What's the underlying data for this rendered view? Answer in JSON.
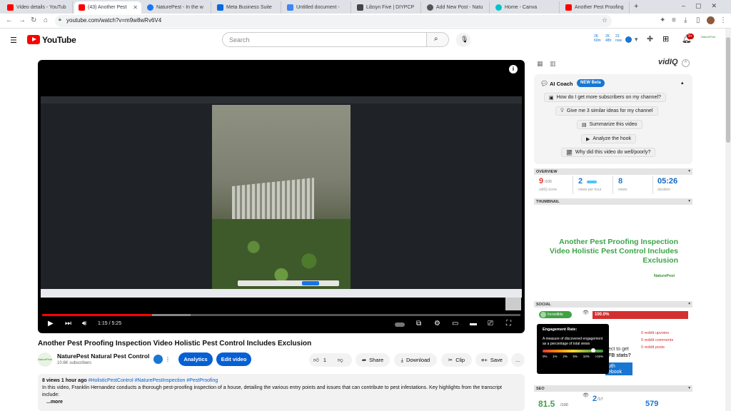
{
  "browser": {
    "tabs": [
      {
        "label": "Video details - YouTub",
        "color": "#ff0000"
      },
      {
        "label": "(43) Another Pest",
        "color": "#ff0000"
      },
      {
        "label": "NaturePest - In the w",
        "color": "#1877f2"
      },
      {
        "label": "Meta Business Suite",
        "color": "#0668e1"
      },
      {
        "label": "Untitled document -",
        "color": "#4285f4"
      },
      {
        "label": "Libsyn Five | DIYPCP",
        "color": "#444444"
      },
      {
        "label": "Add New Post - Natu",
        "color": "#555555"
      },
      {
        "label": "Home - Canva",
        "color": "#00c4cc"
      },
      {
        "label": "Another Pest Proofing",
        "color": "#ff0000"
      }
    ],
    "new_tab": "+",
    "url": "youtube.com/watch?v=m9w8wRv6V4"
  },
  "header": {
    "brand": "YouTube",
    "search_placeholder": "Search"
  },
  "player": {
    "time": "1:15 / 5:25",
    "progress": 0.23,
    "buffered": 0.31,
    "share_bubble": "Share",
    "stop_sharing": "Stop sharing"
  },
  "video": {
    "title": "Another Pest Proofing Inspection Video Holistic Pest Control Includes Exclusion",
    "channel": "NaturePest Natural Pest Control",
    "subscribers": "10.6K subscribers",
    "avatar_text": "NaturePest",
    "buttons": {
      "analytics": "Analytics",
      "edit": "Edit video",
      "likes": "1",
      "share": "Share",
      "download": "Download",
      "clip": "Clip",
      "save": "Save",
      "more": "…"
    },
    "description": {
      "meta": "8 views  1 hour ago",
      "tags": "#HolisticPestControl #NaturePestInspection #PestProofing",
      "text": "In this video, Franklin Hernandez conducts a thorough pest-proofing inspection of a house, detailing the various entry points and issues that can contribute to pest infestations. Key highlights from the transcript include:",
      "more": "...more"
    }
  },
  "vidiq": {
    "logo": "vidIQ",
    "ai_coach": "AI Coach",
    "new_badge": "NEW Beta",
    "ai_buttons": [
      "How do I get more subscribers on my channel?",
      "Give me 3 similar ideas for my channel",
      "Summarize this video",
      "Analyze the hook",
      "Why did this video do well/poorly?"
    ],
    "sections": {
      "overview": "OVERVIEW",
      "thumbnail": "THUMBNAIL",
      "social": "SOCIAL",
      "seo": "SEO"
    },
    "overview": [
      {
        "value": "9",
        "suffix": "/100",
        "label": "vidIQ score",
        "color": "#e53935"
      },
      {
        "value": "2",
        "suffix": "",
        "label": "views per hour",
        "color": "#1976d2"
      },
      {
        "value": "8",
        "suffix": "",
        "label": "views",
        "color": "#1976d2"
      },
      {
        "value": "05:26",
        "suffix": "",
        "label": "duration",
        "color": "#1565c0"
      }
    ],
    "thumbnail_title": "Another Pest Proofing Inspection Video Holistic Pest Control Includes Exclusion",
    "thumbnail_brand": "NaturePest",
    "social": {
      "engagement_label": "Incredible",
      "engagement_value": "100.0%",
      "reddit": [
        "0  reddit upvotes",
        "0  reddit comments",
        "0  reddit posts"
      ],
      "fb_partial_1": "ect to get",
      "fb_partial_2": "FB stats?",
      "fb_button": "uth\nebook"
    },
    "tooltip": {
      "title": "Engagement Rate:",
      "body": "A measure of discovered engagement as a percentage of total views",
      "scale": [
        "0%",
        "1%",
        "2%",
        "5%",
        "10%",
        ">15%"
      ]
    },
    "seo": {
      "score": "81.5",
      "score_suffix": "/100",
      "metric2": "2",
      "metric2_suffix": "/17",
      "metric3": "579"
    }
  }
}
